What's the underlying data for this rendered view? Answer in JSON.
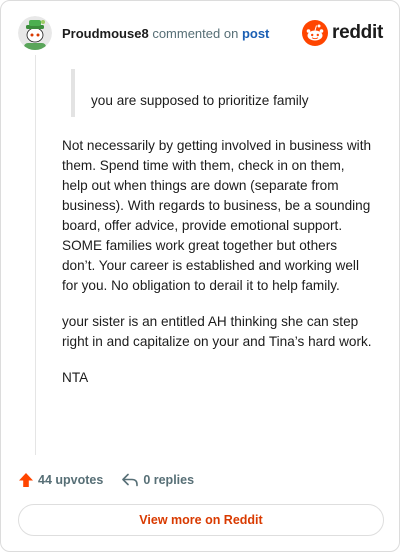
{
  "header": {
    "username": "Proudmouse8",
    "action_text": "commented on",
    "link_text": "post",
    "brand_word": "reddit"
  },
  "comment": {
    "quote": "you are supposed to prioritize family",
    "paragraphs": [
      "Not necessarily by getting involved in business with them. Spend time with them, check in on them, help out when things are down (separate from business). With regards to business, be a sounding board, offer advice, provide emotional support. SOME families work great together but others don’t. Your career is established and working well for you. No obligation to derail it to help family.",
      "your sister is an entitled AH thinking she can step right in and capitalize on your and Tina’s hard work.",
      "NTA"
    ]
  },
  "footer": {
    "upvotes_label": "44 upvotes",
    "replies_label": "0 replies",
    "view_more_label": "View more on Reddit"
  },
  "colors": {
    "brand_orange": "#ff4500",
    "link_blue": "#1a5fb4",
    "view_more_text": "#d93a00",
    "meta_gray": "#576f76"
  },
  "icons": {
    "avatar": "snoo-avatar-green-hat",
    "brand": "reddit-logo-icon",
    "upvote": "upvote-arrow-icon",
    "reply": "reply-arrow-icon"
  }
}
